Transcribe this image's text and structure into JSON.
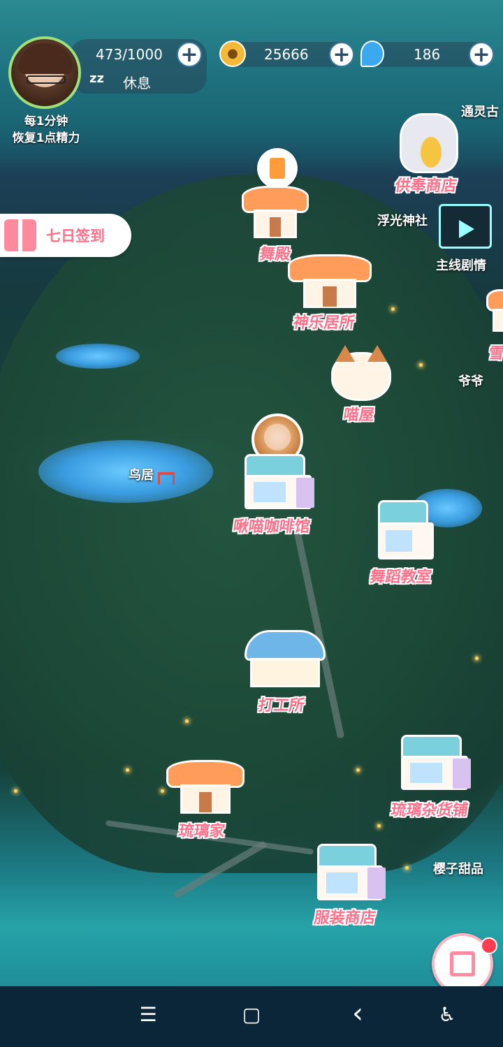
{
  "hud": {
    "energy": "473/1000",
    "status": "休息",
    "status_icon": "zz",
    "coins": "25666",
    "gems": "186",
    "regen_line1": "每1分钟",
    "regen_line2": "恢复1点精力"
  },
  "buttons": {
    "checkin": "七日签到",
    "main_story": "主线剧情"
  },
  "locations": {
    "offering_shop": "供奉商店",
    "dance_hall": "舞殿",
    "kagura_residence": "神乐居所",
    "cat_house": "喵屋",
    "cafe": "啾喵咖啡馆",
    "dance_class": "舞蹈教室",
    "work_office": "打工所",
    "ruri_home": "琉璃家",
    "ruri_store": "琉璃杂货铺",
    "clothing_store": "服装商店"
  },
  "map_labels": {
    "torii": "鸟居",
    "shrine": "浮光神社",
    "grandpa": "爷爷",
    "sakura_sweets": "樱子甜品",
    "tongling": "通灵古",
    "snow": "雪"
  },
  "nav": {
    "menu": "☰",
    "home": "▢",
    "back": "‹",
    "accessibility": "♿"
  },
  "colors": {
    "label_pink": "#ff6f8a",
    "accent_green": "#9fe07a",
    "notification_red": "#ff3b4f"
  }
}
